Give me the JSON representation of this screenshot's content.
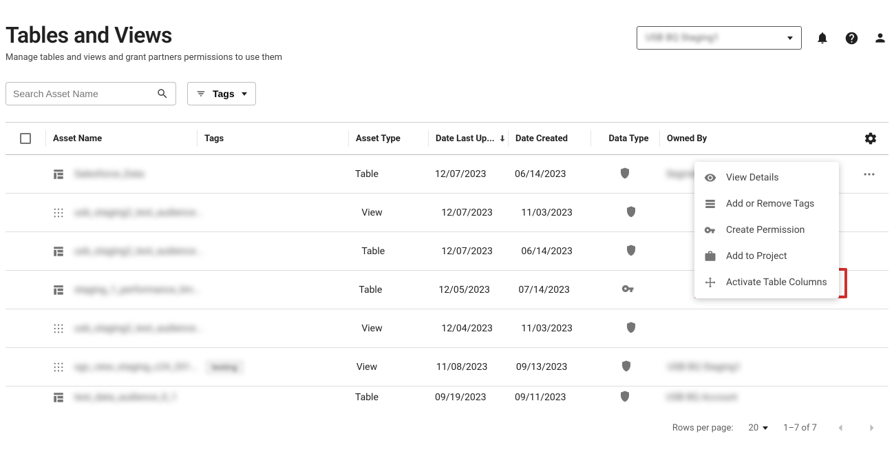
{
  "header": {
    "title": "Tables and Views",
    "subtitle": "Manage tables and views and grant partners permissions to use them",
    "account_selected": "USB BQ Staging1"
  },
  "toolbar": {
    "search_placeholder": "Search Asset Name",
    "tags_label": "Tags"
  },
  "columns": {
    "asset_name": "Asset Name",
    "tags": "Tags",
    "asset_type": "Asset Type",
    "updated": "Date Last Up...",
    "created": "Date Created",
    "data_type": "Data Type",
    "owned_by": "Owned By"
  },
  "rows": [
    {
      "icon": "table",
      "name": "Salesforce_Data",
      "type": "Table",
      "updated": "12/07/2023",
      "created": "06/14/2023",
      "datatype": "shield",
      "owned": "Segment Builder Staging1",
      "tag": "",
      "kebab": true
    },
    {
      "icon": "view",
      "name": "usb_staging2_test_audience...",
      "type": "View",
      "updated": "12/07/2023",
      "created": "11/03/2023",
      "datatype": "shield",
      "owned": "",
      "tag": "",
      "kebab": false
    },
    {
      "icon": "table",
      "name": "usb_staging2_test_audience...",
      "type": "Table",
      "updated": "12/07/2023",
      "created": "06/14/2023",
      "datatype": "shield",
      "owned": "",
      "tag": "",
      "kebab": false
    },
    {
      "icon": "table",
      "name": "staging_1_performance_lim...",
      "type": "Table",
      "updated": "12/05/2023",
      "created": "07/14/2023",
      "datatype": "key",
      "owned": "",
      "tag": "",
      "kebab": false
    },
    {
      "icon": "view",
      "name": "usb_staging2_test_audience...",
      "type": "View",
      "updated": "12/04/2023",
      "created": "11/03/2023",
      "datatype": "shield",
      "owned": "",
      "tag": "",
      "kebab": false
    },
    {
      "icon": "view",
      "name": "sgc_view_staging_c24_201...",
      "type": "View",
      "updated": "11/08/2023",
      "created": "09/13/2023",
      "datatype": "shield",
      "owned": "USB BQ Staging1",
      "tag": "testing",
      "kebab": false
    },
    {
      "icon": "table",
      "name": "test_data_audience_0_1",
      "type": "Table",
      "updated": "09/19/2023",
      "created": "09/11/2023",
      "datatype": "shield",
      "owned": "USB BQ Account",
      "tag": "",
      "kebab": false
    }
  ],
  "menu": {
    "view_details": "View Details",
    "tags": "Add or Remove Tags",
    "permission": "Create Permission",
    "project": "Add to Project",
    "activate": "Activate Table Columns"
  },
  "footer": {
    "rpp_label": "Rows per page:",
    "rpp_value": "20",
    "range": "1–7 of 7"
  }
}
